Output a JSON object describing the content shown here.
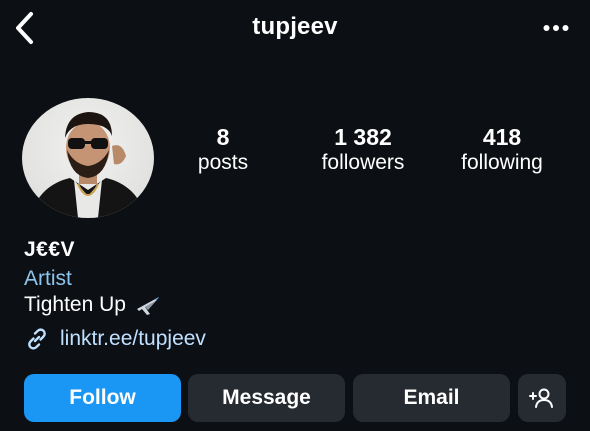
{
  "header": {
    "username": "tupjeev",
    "back_icon": "chevron-left-icon",
    "more_icon": "more-horizontal-icon"
  },
  "profile": {
    "stats": [
      {
        "value": "8",
        "label": "posts"
      },
      {
        "value": "1 382",
        "label": "followers"
      },
      {
        "value": "418",
        "label": "following"
      }
    ]
  },
  "bio": {
    "name": "J€€V",
    "category": "Artist",
    "text": "Tighten Up",
    "text_emoji": "airplane-icon",
    "link_icon": "link-icon",
    "link": "linktr.ee/tupjeev"
  },
  "actions": {
    "follow": "Follow",
    "message": "Message",
    "email": "Email",
    "suggest_icon": "add-person-icon"
  },
  "colors": {
    "background": "#0c0f14",
    "accent": "#1a97f5",
    "secondary_button": "#262a31",
    "category_text": "#8ec5ee",
    "link_text": "#bfe0ff"
  }
}
